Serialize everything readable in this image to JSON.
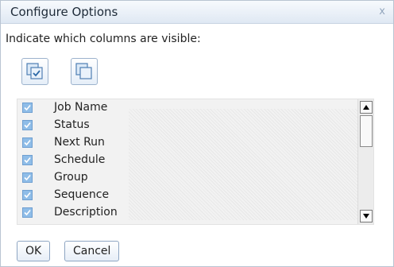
{
  "dialog": {
    "title": "Configure Options",
    "close_glyph": "x",
    "instructions": "Indicate which columns are visible:"
  },
  "toolbar": {
    "select_all_icon": "select-all-icon",
    "deselect_all_icon": "deselect-all-icon"
  },
  "columns": [
    {
      "label": "Job Name",
      "checked": true
    },
    {
      "label": "Status",
      "checked": true
    },
    {
      "label": "Next Run",
      "checked": true
    },
    {
      "label": "Schedule",
      "checked": true
    },
    {
      "label": "Group",
      "checked": true
    },
    {
      "label": "Sequence",
      "checked": true
    },
    {
      "label": "Description",
      "checked": true
    }
  ],
  "buttons": {
    "ok": "OK",
    "cancel": "Cancel"
  },
  "colors": {
    "titlebar": "#dfe8f3",
    "checkbox": "#8fbde8",
    "button_border": "#8ea6c3"
  }
}
